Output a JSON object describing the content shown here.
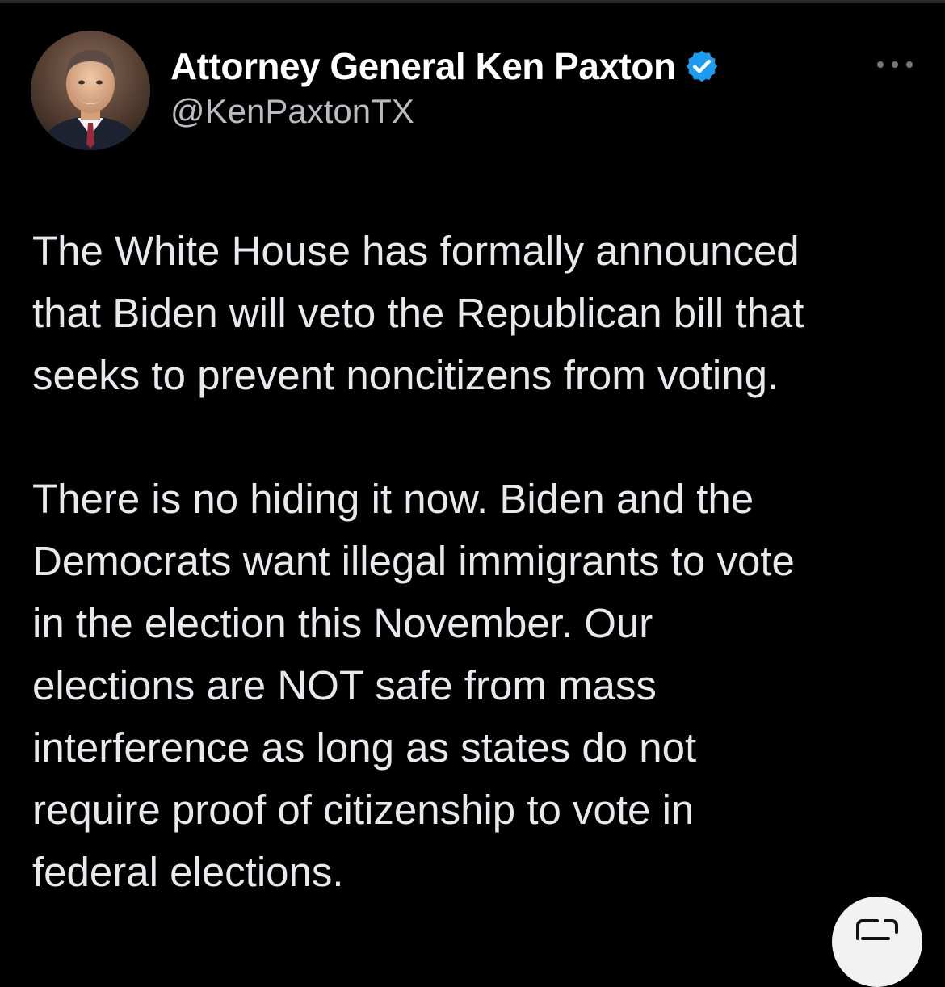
{
  "author": {
    "display_name": "Attorney General Ken Paxton",
    "handle": "@KenPaxtonTX",
    "verified": true,
    "verified_badge_color": "#1d9bf0",
    "avatar": "profile-photo"
  },
  "tweet": {
    "paragraphs": [
      "The White House has formally announced\nthat Biden will veto the Republican bill that\nseeks to prevent noncitizens from voting.",
      "There is no hiding it now. Biden and the\nDemocrats want illegal immigrants to vote\nin the election this November. Our\nelections are NOT safe from mass\ninterference as long as states do not\nrequire proof of citizenship to vote in\nfederal elections."
    ]
  },
  "ui": {
    "more_icon": "more-horizontal-icon",
    "corner_icon": "screen-capture-icon",
    "background": "#000000",
    "text_color": "#e7e9ea",
    "handle_color": "#b8bcc0"
  }
}
